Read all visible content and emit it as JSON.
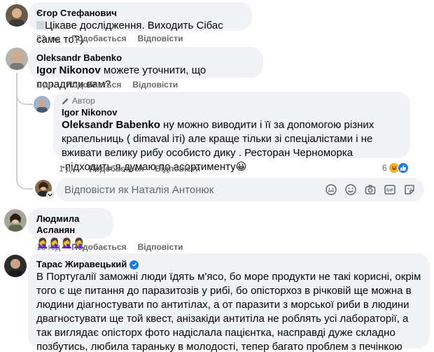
{
  "comments": [
    {
      "author": "Єгор Стефанович",
      "text": "Цікаве дослідження. Виходить Сібас саме то?)",
      "time": "23 год",
      "like": "Подобається",
      "reply": "Відповісти"
    },
    {
      "author": "Oleksandr Babenko",
      "mention": "Igor Nikonov",
      "text": " можете уточнити, що порадили вам?",
      "time": "1 дн.",
      "like": "Подобається",
      "reply": "Відповісти"
    },
    {
      "badge": "Автор",
      "author": "Igor Nikonov",
      "mention": "Oleksandr Babenko",
      "text": " ну можно виводити і її за допомогою різних крапельниць ( dimaval іті) але краще тільки зі спеціалістами і не вживати велику рибу особисто дику . Ресторан Черноморка -підходить я думаю по асортименту",
      "emoji_end": "😀",
      "time": "1 дн.",
      "like": "Подобається",
      "reply": "Відповісти",
      "reaction_count": "6",
      "reactions": [
        "haha",
        "like"
      ]
    },
    {
      "author": "Людмила Асланян",
      "text": "🤦‍♀️🤦‍♀️🤦‍♀️🤦‍♀️",
      "time": "15 год",
      "like": "Подобається",
      "reply": "Відповісти"
    },
    {
      "author": "Тарас Жиравецький",
      "verified": true,
      "text": "В Португалії заможні люди їдять м'ясо, бо море продукти не такі корисні, окрім того є ще питання до паразитозів у рибі, бо опісторхоз в річковій ще можна в людини діагностувати по антитілах, а от паразити з морської риби в людини двагностувати ще той квест, анізакіди антитіла не роблять усі лабораторії, а так виглядає опісторх фото надіслала пацієнтка, насправді дуже складно позбутись, любила тараньку в молодості, тепер багато проблем з печінкою"
    }
  ],
  "reply_box": {
    "placeholder": "Відповісти як Наталія Антонюк"
  },
  "colors": {
    "bubble": "#f0f2f5",
    "secondary_text": "#65676b",
    "primary_blue": "#1877f2",
    "haha_yellow": "#f7b125"
  }
}
